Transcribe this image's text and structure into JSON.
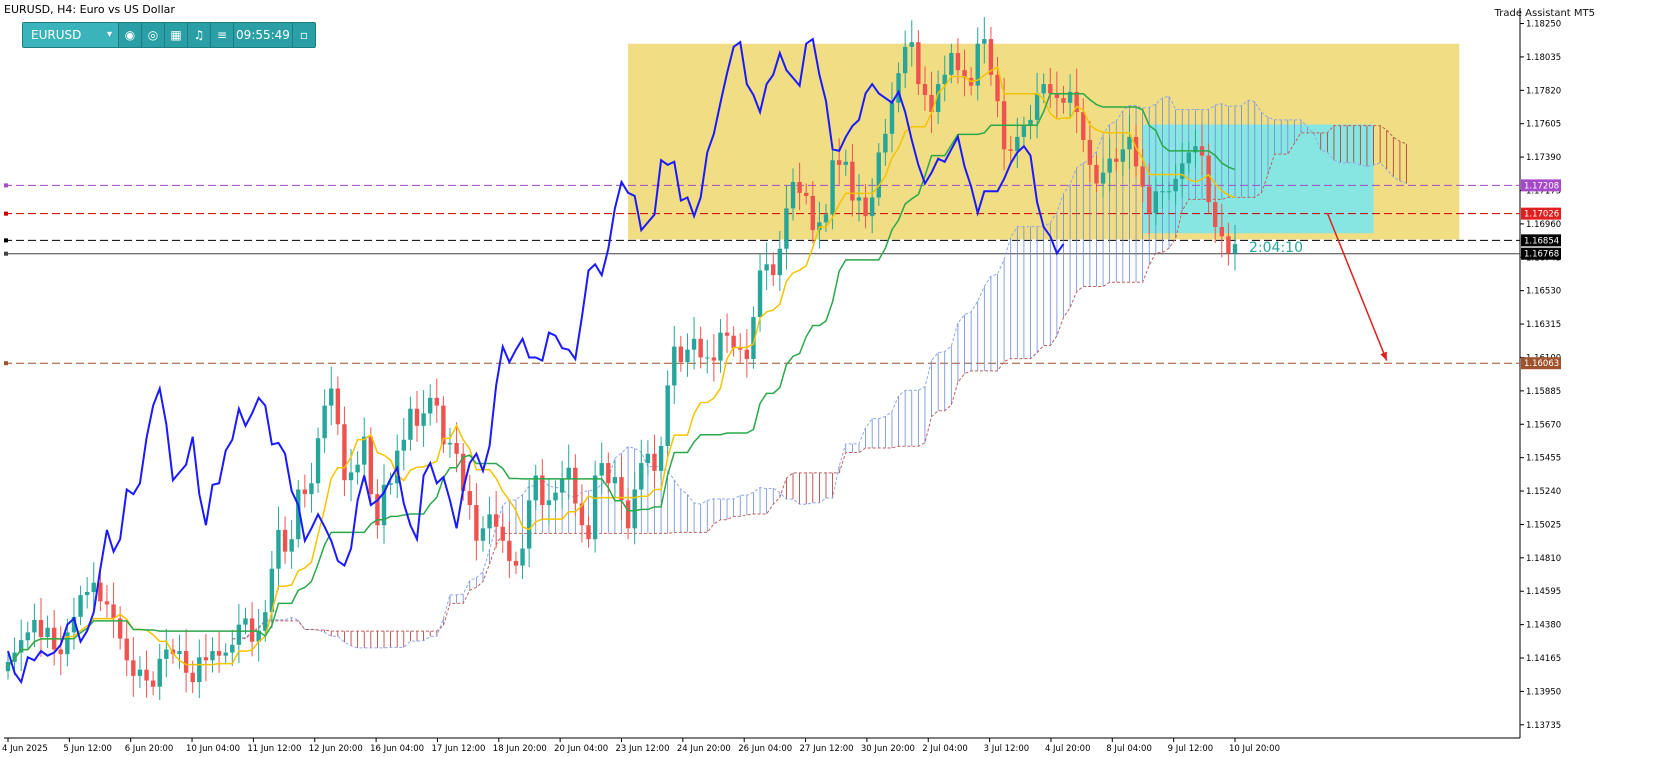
{
  "header": {
    "title": "EURUSD, H4:  Euro vs US Dollar",
    "assistant": "Trade Assistant MT5"
  },
  "toolbar": {
    "symbol": "EURUSD",
    "time": "09:55:49",
    "icons": [
      "camera-icon",
      "eye-icon",
      "calendar-icon",
      "alarm-bell-icon",
      "menu-icon"
    ],
    "close_icon": "window-icon"
  },
  "chart_data": {
    "type": "candlestick",
    "symbol": "EURUSD",
    "timeframe": "H4",
    "ylim": [
      1.1365,
      1.1835
    ],
    "y_ticks": [
      "1.18250",
      "1.18035",
      "1.17820",
      "1.17605",
      "1.17390",
      "1.17175",
      "1.16960",
      "1.16745",
      "1.16530",
      "1.16315",
      "1.16100",
      "1.15885",
      "1.15670",
      "1.15455",
      "1.15240",
      "1.15025",
      "1.14810",
      "1.14595",
      "1.14380",
      "1.14165",
      "1.13950",
      "1.13735"
    ],
    "x_labels": [
      "4 Jun 2025",
      "5 Jun 12:00",
      "6 Jun 20:00",
      "10 Jun 04:00",
      "11 Jun 12:00",
      "12 Jun 20:00",
      "16 Jun 04:00",
      "17 Jun 12:00",
      "18 Jun 20:00",
      "20 Jun 04:00",
      "23 Jun 12:00",
      "24 Jun 20:00",
      "26 Jun 04:00",
      "27 Jun 12:00",
      "30 Jun 20:00",
      "2 Jul 04:00",
      "3 Jul 12:00",
      "4 Jul 20:00",
      "8 Jul 04:00",
      "9 Jul 12:00",
      "10 Jul 20:00"
    ],
    "price_labels": [
      {
        "value": 1.17208,
        "text": "1.17208",
        "color": "#a64ac9"
      },
      {
        "value": 1.17026,
        "text": "1.17026",
        "color": "#e02020"
      },
      {
        "value": 1.16854,
        "text": "1.16854",
        "color": "#000000"
      },
      {
        "value": 1.16768,
        "text": "1.16768",
        "color": "#000000"
      },
      {
        "value": 1.16063,
        "text": "1.16063",
        "color": "#a0522d"
      }
    ],
    "horizontal_lines": [
      {
        "value": 1.17208,
        "color": "#a64ac9",
        "style": "dashed"
      },
      {
        "value": 1.17026,
        "color": "#cc0000",
        "style": "dashed"
      },
      {
        "value": 1.16854,
        "color": "#000000",
        "style": "dashed"
      },
      {
        "value": 1.16768,
        "color": "#444444",
        "style": "solid"
      },
      {
        "value": 1.16063,
        "color": "#a0522d",
        "style": "dashed"
      }
    ],
    "timer_text": "2:04:10",
    "zones": [
      {
        "from_bar": 94,
        "to_bar": 220,
        "top": 1.1812,
        "bottom": 1.1686,
        "color": "#f0dd84"
      },
      {
        "from_bar": 172,
        "to_bar": 207,
        "top": 1.176,
        "bottom": 1.169,
        "color": "#88e6e2"
      }
    ],
    "arrow": {
      "from_bar": 200,
      "from_value": 1.1703,
      "to_bar": 209,
      "to_value": 1.1608,
      "color": "#e02020"
    },
    "closes": [
      1.1414,
      1.142,
      1.1428,
      1.1433,
      1.1441,
      1.143,
      1.1436,
      1.1422,
      1.1419,
      1.1433,
      1.1443,
      1.1457,
      1.1459,
      1.1465,
      1.1453,
      1.1451,
      1.1442,
      1.1429,
      1.1415,
      1.1405,
      1.1409,
      1.1402,
      1.1398,
      1.1416,
      1.1422,
      1.1419,
      1.1421,
      1.1407,
      1.1401,
      1.1417,
      1.1415,
      1.1421,
      1.1418,
      1.142,
      1.1425,
      1.1438,
      1.1442,
      1.1427,
      1.1434,
      1.1446,
      1.1474,
      1.1499,
      1.1485,
      1.1493,
      1.1525,
      1.1522,
      1.1529,
      1.1558,
      1.1579,
      1.159,
      1.1567,
      1.1531,
      1.1536,
      1.1541,
      1.1559,
      1.1522,
      1.1502,
      1.1528,
      1.1529,
      1.155,
      1.1557,
      1.1577,
      1.1566,
      1.1574,
      1.1584,
      1.1579,
      1.1554,
      1.1555,
      1.1548,
      1.1524,
      1.1515,
      1.1492,
      1.15,
      1.1509,
      1.1501,
      1.1492,
      1.1479,
      1.1476,
      1.1487,
      1.1518,
      1.1534,
      1.1515,
      1.1518,
      1.1523,
      1.1532,
      1.1539,
      1.1516,
      1.1502,
      1.1493,
      1.1534,
      1.1542,
      1.1529,
      1.1533,
      1.1518,
      1.15,
      1.1525,
      1.1542,
      1.1548,
      1.1537,
      1.1553,
      1.1592,
      1.1617,
      1.1607,
      1.1615,
      1.1622,
      1.161,
      1.161,
      1.1608,
      1.1626,
      1.1624,
      1.1616,
      1.1615,
      1.1609,
      1.1636,
      1.1666,
      1.167,
      1.1663,
      1.168,
      1.1706,
      1.1723,
      1.1716,
      1.1714,
      1.1692,
      1.1697,
      1.1702,
      1.1737,
      1.1734,
      1.1736,
      1.1711,
      1.1713,
      1.1701,
      1.1713,
      1.1742,
      1.1754,
      1.1774,
      1.1793,
      1.181,
      1.1813,
      1.1786,
      1.1779,
      1.1768,
      1.1786,
      1.1792,
      1.1806,
      1.1795,
      1.179,
      1.1785,
      1.1812,
      1.1815,
      1.1792,
      1.1775,
      1.1744,
      1.1743,
      1.1752,
      1.1759,
      1.1763,
      1.178,
      1.1786,
      1.178,
      1.1777,
      1.1774,
      1.1781,
      1.1768,
      1.175,
      1.1734,
      1.1722,
      1.1729,
      1.1738,
      1.1736,
      1.1744,
      1.1752,
      1.1733,
      1.172,
      1.1703,
      1.1717,
      1.1717,
      1.1717,
      1.1725,
      1.1735,
      1.1742,
      1.1746,
      1.174,
      1.171,
      1.1694,
      1.1688,
      1.1677,
      1.1683
    ]
  }
}
